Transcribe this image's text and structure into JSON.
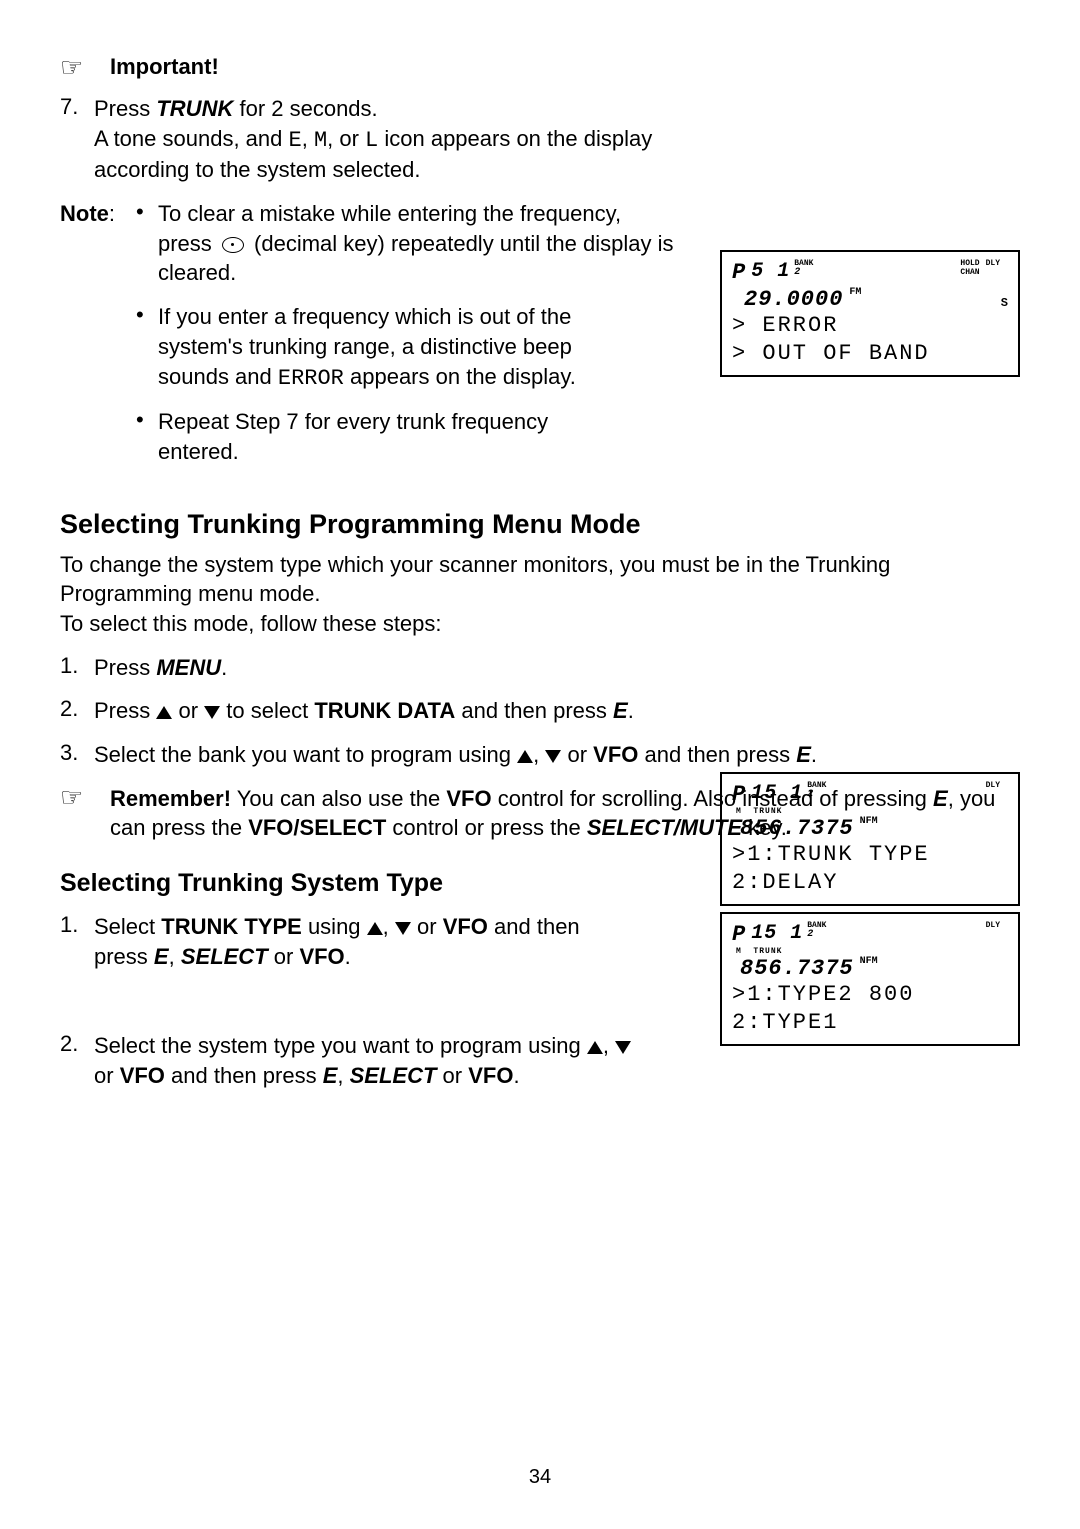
{
  "important_label": "Important!",
  "step7_num": "7.",
  "step7_line1_a": "Press ",
  "step7_line1_key": "TRUNK",
  "step7_line1_b": " for 2 seconds.",
  "step7_line2_a": "A tone sounds, and ",
  "step7_line2_e": "E",
  "step7_line2_m": "M",
  "step7_line2_l": "L",
  "step7_line2_b": " icon appears on the display according to the system selected.",
  "note_label": "Note",
  "note_items": [
    {
      "a": "To clear a mistake while entering the frequency, press ",
      "b": " (decimal key) repeatedly until the display is cleared."
    },
    {
      "a": "If you enter a frequency which is out of the system's trunking range, a distinctive beep sounds and ",
      "err": "ERROR",
      "b": " appears on the display."
    },
    {
      "a": "Repeat Step 7 for every trunk frequency entered.",
      "b": ""
    }
  ],
  "lcd1": {
    "P": "P",
    "bank_num": "5 1",
    "bank_label": "BANK",
    "sub_num": "2",
    "hold": "HOLD",
    "chan": "CHAN",
    "dly": "DLY",
    "freq": "29.0000",
    "mode": "FM",
    "s": "S",
    "line1": "> ERROR",
    "line2": "> OUT OF BAND"
  },
  "section1_title": "Selecting Trunking Programming Menu Mode",
  "section1_intro": "To change the system type which your scanner monitors, you must be in the Trunking Programming menu mode.\nTo select this mode, follow these steps:",
  "s1_step1_num": "1.",
  "s1_step1_a": "Press ",
  "s1_step1_key": "MENU",
  "s1_step1_b": ".",
  "s1_step2_num": "2.",
  "s1_step2_a": "Press ",
  "s1_step2_b": " or ",
  "s1_step2_c": " to select ",
  "s1_step2_td": "TRUNK DATA",
  "s1_step2_d": " and then press ",
  "s1_step2_e": "E",
  "s1_step2_f": ".",
  "s1_step3_num": "3.",
  "s1_step3_a": "Select the bank you want to program using ",
  "s1_step3_b": ", ",
  "s1_step3_c": " or ",
  "s1_step3_vfo": "VFO",
  "s1_step3_d": " and then press ",
  "s1_step3_e": "E",
  "s1_step3_f": ".",
  "remember_label": "Remember!",
  "remember_a": " You can also use the ",
  "remember_vfo": "VFO",
  "remember_b": " control for scrolling. Also instead of pressing ",
  "remember_e": "E",
  "remember_c": ", you can press the ",
  "remember_vs": "VFO/SELECT",
  "remember_d": " control or press the ",
  "remember_sm": "SELECT/MUTE",
  "remember_f": " key.",
  "section2_title": "Selecting Trunking System Type",
  "s2_step1_num": "1.",
  "s2_step1_a": "Select ",
  "s2_step1_tt": "TRUNK TYPE",
  "s2_step1_b": " using ",
  "s2_step1_c": ", ",
  "s2_step1_d": " or ",
  "s2_step1_vfo": "VFO",
  "s2_step1_e": " and then press ",
  "s2_step1_E": "E",
  "s2_step1_f": ", ",
  "s2_step1_sel": "SELECT",
  "s2_step1_g": " or ",
  "s2_step1_vfo2": "VFO",
  "s2_step1_h": ".",
  "s2_step2_num": "2.",
  "s2_step2_a": "Select the system type you want to program using ",
  "s2_step2_b": ", ",
  "s2_step2_c": " or ",
  "s2_step2_vfo": "VFO",
  "s2_step2_d": " and then press ",
  "s2_step2_E": "E",
  "s2_step2_e": ", ",
  "s2_step2_sel": "SELECT",
  "s2_step2_f": " or ",
  "s2_step2_vfo2": "VFO",
  "s2_step2_g": ".",
  "lcd2": {
    "P": "P",
    "bank_num": "15 1",
    "bank_label": "BANK",
    "sub_num": "2",
    "dly": "DLY",
    "m": "M",
    "trunk": "TRUNK",
    "freq": "856.7375",
    "mode": "NFM",
    "line1": ">1:TRUNK TYPE",
    "line2": " 2:DELAY"
  },
  "lcd3": {
    "P": "P",
    "bank_num": "15 1",
    "bank_label": "BANK",
    "sub_num": "2",
    "dly": "DLY",
    "m": "M",
    "trunk": "TRUNK",
    "freq": "856.7375",
    "mode": "NFM",
    "line1": ">1:TYPE2 800",
    "line2": " 2:TYPE1"
  },
  "page_number": "34"
}
